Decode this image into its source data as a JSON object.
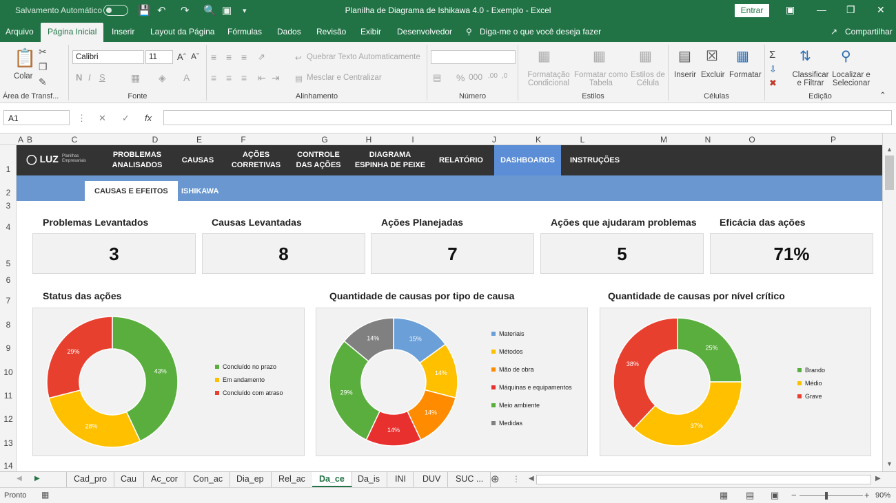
{
  "titlebar": {
    "autosave": "Salvamento Automático",
    "title": "Planilha de Diagrama de Ishikawa 4.0 - Exemplo  -  Excel",
    "signin": "Entrar"
  },
  "menu": {
    "items": [
      "Arquivo",
      "Página Inicial",
      "Inserir",
      "Layout da Página",
      "Fórmulas",
      "Dados",
      "Revisão",
      "Exibir",
      "Desenvolvedor"
    ],
    "tell": "Diga-me o que você deseja fazer",
    "share": "Compartilhar"
  },
  "ribbon": {
    "paste": "Colar",
    "clipboard": "Área de Transf...",
    "font_name": "Calibri",
    "font_size": "11",
    "font_group": "Fonte",
    "wrap": "Quebrar Texto Automaticamente",
    "merge": "Mesclar e Centralizar",
    "align_group": "Alinhamento",
    "number_group": "Número",
    "cond_format": "Formatação\nCondicional",
    "format_table": "Formatar como\nTabela",
    "cell_styles": "Estilos de\nCélula",
    "styles_group": "Estilos",
    "insert": "Inserir",
    "delete": "Excluir",
    "format": "Formatar",
    "cells_group": "Células",
    "sort": "Classificar\ne Filtrar",
    "find": "Localizar e\nSelecionar",
    "edit_group": "Edição"
  },
  "formula": {
    "namebox": "A1",
    "fx": "fx"
  },
  "columns": [
    "A",
    "B",
    "C",
    "D",
    "E",
    "F",
    "G",
    "H",
    "I",
    "J",
    "K",
    "L",
    "M",
    "N",
    "O",
    "P"
  ],
  "rows": [
    "1",
    "2",
    "3",
    "4",
    "5",
    "6",
    "7",
    "8",
    "9",
    "10",
    "11",
    "12",
    "13",
    "14"
  ],
  "dashboard": {
    "logo": "LUZ",
    "logo_sub": "Planilhas Empresariais",
    "nav": [
      "PROBLEMAS\nANALISADOS",
      "CAUSAS",
      "AÇÕES\nCORRETIVAS",
      "CONTROLE\nDAS AÇÕES",
      "DIAGRAMA\nESPINHA DE PEIXE",
      "RELATÓRIO",
      "DASHBOARDS",
      "INSTRUÇÕES"
    ],
    "subtabs": [
      "CAUSAS E EFEITOS",
      "ISHIKAWA"
    ],
    "kpis": [
      {
        "label": "Problemas Levantados",
        "value": "3"
      },
      {
        "label": "Causas Levantadas",
        "value": "8"
      },
      {
        "label": "Ações Planejadas",
        "value": "7"
      },
      {
        "label": "Ações que ajudaram problemas",
        "value": "5"
      },
      {
        "label": "Eficácia das ações",
        "value": "71%"
      }
    ]
  },
  "chart_data": [
    {
      "type": "pie",
      "title": "Status das ações",
      "labels": [
        "Concluído no prazo",
        "Em andamento",
        "Concluído com atraso"
      ],
      "values": [
        43,
        28,
        29
      ],
      "colors": [
        "#5aae3e",
        "#ffc000",
        "#e8402f"
      ]
    },
    {
      "type": "pie",
      "title": "Quantidade de causas por tipo de causa",
      "labels": [
        "Materiais",
        "Métodos",
        "Mão de obra",
        "Máquinas e equipamentos",
        "Meio ambiente",
        "Medidas"
      ],
      "values": [
        15,
        14,
        14,
        14,
        29,
        14
      ],
      "colors": [
        "#6a9fd8",
        "#ffc000",
        "#ff8c00",
        "#e8302f",
        "#5aae3e",
        "#808080"
      ]
    },
    {
      "type": "pie",
      "title": "Quantidade de causas por nível crítico",
      "labels": [
        "Brando",
        "Médio",
        "Grave"
      ],
      "values": [
        25,
        37,
        38
      ],
      "colors": [
        "#5aae3e",
        "#ffc000",
        "#e8402f"
      ]
    }
  ],
  "sheet_tabs": [
    "Cad_pro",
    "Cau",
    "Ac_cor",
    "Con_ac",
    "Dia_ep",
    "Rel_ac",
    "Da_ce",
    "Da_is",
    "INI",
    "DUV",
    "SUC ..."
  ],
  "status": {
    "ready": "Pronto",
    "zoom": "90%"
  }
}
